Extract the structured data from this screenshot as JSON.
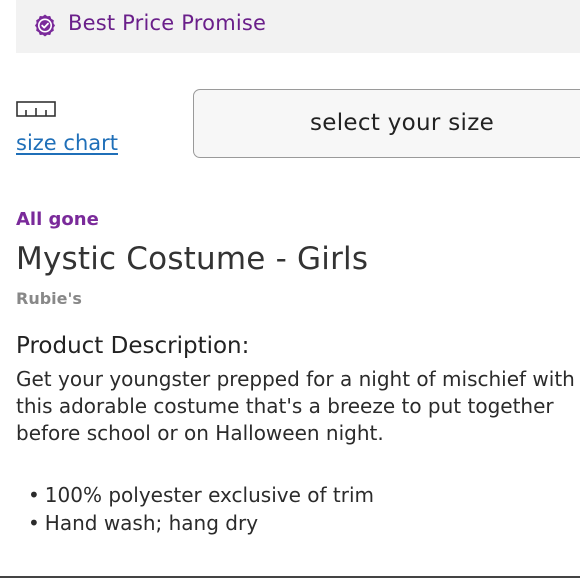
{
  "promise": {
    "label": "Best Price Promise",
    "icon": "badge-check-icon",
    "color": "#6a1f8a"
  },
  "size": {
    "chart_link": "size chart",
    "chart_icon": "ruler-icon",
    "select_label": "select your size"
  },
  "product": {
    "stock_status": "All gone",
    "title": "Mystic Costume - Girls",
    "brand": "Rubie's"
  },
  "description": {
    "heading": "Product Description:",
    "body": "Get your youngster prepped for a night of mischief with this adorable costume that's a breeze to put together before school or on Halloween night.",
    "bullets": [
      "100% polyester exclusive of trim",
      "Hand wash; hang dry"
    ]
  },
  "colors": {
    "accent": "#6a1f8a",
    "link": "#1f6fb8"
  }
}
